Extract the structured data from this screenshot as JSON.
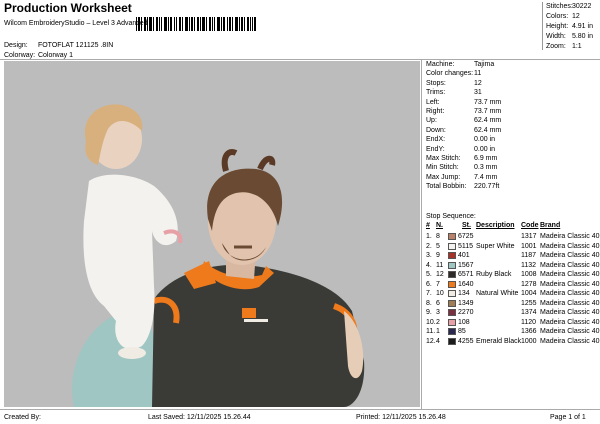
{
  "header": {
    "title": "Production Worksheet",
    "subtitle": "Wilcom EmbroideryStudio – Level 3 Advanced",
    "design_label": "Design:",
    "design_value": "FOTOFLAT 121125 .8IN",
    "colorway_label": "Colorway:",
    "colorway_value": "Colorway 1"
  },
  "summary": {
    "stitches_label": "Stitches:",
    "stitches_value": "30222",
    "colors_label": "Colors:",
    "colors_value": "12",
    "height_label": "Height:",
    "height_value": "4.91 in",
    "width_label": "Width:",
    "width_value": "5.80 in",
    "zoom_label": "Zoom:",
    "zoom_value": "1:1"
  },
  "details": [
    {
      "label": "Machine:",
      "value": "Tajima"
    },
    {
      "label": "Color changes:",
      "value": "11"
    },
    {
      "label": "Stops:",
      "value": "12"
    },
    {
      "label": "Trims:",
      "value": "31"
    },
    {
      "label": "Left:",
      "value": "73.7 mm"
    },
    {
      "label": "Right:",
      "value": "73.7 mm"
    },
    {
      "label": "Up:",
      "value": "62.4 mm"
    },
    {
      "label": "Down:",
      "value": "62.4 mm"
    },
    {
      "label": "EndX:",
      "value": "0.00 in"
    },
    {
      "label": "EndY:",
      "value": "0.00 in"
    },
    {
      "label": "Max Stitch:",
      "value": "6.9 mm"
    },
    {
      "label": "Min Stitch:",
      "value": "0.3 mm"
    },
    {
      "label": "Max Jump:",
      "value": "7.4 mm"
    },
    {
      "label": "Total Bobbin:",
      "value": "220.77ft"
    }
  ],
  "stop_sequence": {
    "title": "Stop Sequence:",
    "headers": {
      "num": "#",
      "n": "N.",
      "st": "St.",
      "description": "Description",
      "code": "Code",
      "brand": "Brand"
    },
    "rows": [
      {
        "num": "1.",
        "n": "8",
        "color": "#b9806a",
        "st": "6725",
        "description": "",
        "code": "1317",
        "brand": "Madeira Classic 40"
      },
      {
        "num": "2.",
        "n": "5",
        "color": "#f4f2ee",
        "st": "5115",
        "description": "Super White",
        "code": "1001",
        "brand": "Madeira Classic 40"
      },
      {
        "num": "3.",
        "n": "9",
        "color": "#a83228",
        "st": "401",
        "description": "",
        "code": "1187",
        "brand": "Madeira Classic 40"
      },
      {
        "num": "4.",
        "n": "11",
        "color": "#9fc6c2",
        "st": "1567",
        "description": "",
        "code": "1132",
        "brand": "Madeira Classic 40"
      },
      {
        "num": "5.",
        "n": "12",
        "color": "#2e2a28",
        "st": "6571",
        "description": "Ruby Black",
        "code": "1008",
        "brand": "Madeira Classic 40"
      },
      {
        "num": "6.",
        "n": "7",
        "color": "#ee7a1c",
        "st": "1640",
        "description": "",
        "code": "1278",
        "brand": "Madeira Classic 40"
      },
      {
        "num": "7.",
        "n": "10",
        "color": "#f0ece4",
        "st": "134",
        "description": "Natural White",
        "code": "1004",
        "brand": "Madeira Classic 40"
      },
      {
        "num": "8.",
        "n": "6",
        "color": "#9e7c56",
        "st": "1349",
        "description": "",
        "code": "1255",
        "brand": "Madeira Classic 40"
      },
      {
        "num": "9.",
        "n": "3",
        "color": "#7a3040",
        "st": "2270",
        "description": "",
        "code": "1374",
        "brand": "Madeira Classic 40"
      },
      {
        "num": "10.",
        "n": "2",
        "color": "#e6a0a6",
        "st": "108",
        "description": "",
        "code": "1120",
        "brand": "Madeira Classic 40"
      },
      {
        "num": "11.",
        "n": "1",
        "color": "#2a2850",
        "st": "85",
        "description": "",
        "code": "1366",
        "brand": "Madeira Classic 40"
      },
      {
        "num": "12.",
        "n": "4",
        "color": "#1c1c1c",
        "st": "4255",
        "description": "Emerald Black",
        "code": "1000",
        "brand": "Madeira Classic 40"
      }
    ]
  },
  "footer": {
    "created": "Created By:",
    "saved": "Last Saved: 12/11/2025 15.26.44",
    "printed": "Printed: 12/11/2025 15.26.48",
    "page": "Page 1 of 1"
  }
}
